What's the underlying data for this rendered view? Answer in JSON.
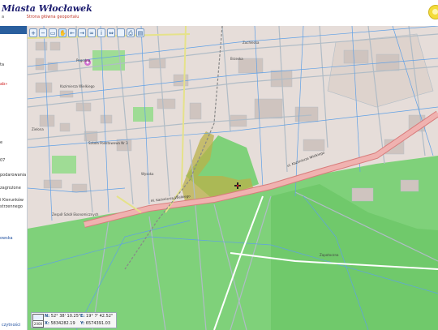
{
  "header": {
    "title": "Miasta Włocławek",
    "subnav_left": "a",
    "subnav_link": "Strona główna geoportalu"
  },
  "sidebar": {
    "items": [
      {
        "label": "ta",
        "style": "normal"
      },
      {
        "label": "ab»",
        "style": "red"
      },
      {
        "label": "e",
        "style": "normal"
      },
      {
        "label": "07",
        "style": "normal"
      },
      {
        "label": "podarowania",
        "style": "normal"
      },
      {
        "label": "zagrożone",
        "style": "normal"
      },
      {
        "label": "i Kierunków",
        "style": "normal"
      },
      {
        "label": "strzennego",
        "style": "normal"
      },
      {
        "label": "owska",
        "style": "blue"
      }
    ],
    "footer_link": "czytności"
  },
  "toolbar": {
    "tools": [
      {
        "name": "zoom-in-icon",
        "glyph": "+"
      },
      {
        "name": "zoom-out-icon",
        "glyph": "−"
      },
      {
        "name": "zoom-box-icon",
        "glyph": "▭"
      },
      {
        "name": "pan-hand-icon",
        "glyph": "✋"
      },
      {
        "name": "back-arrow-icon",
        "glyph": "←"
      },
      {
        "name": "forward-arrow-icon",
        "glyph": "→"
      },
      {
        "name": "link-icon",
        "glyph": "∞"
      },
      {
        "name": "info-icon",
        "glyph": "i"
      },
      {
        "name": "measure-icon",
        "glyph": "⇔"
      },
      {
        "name": "blank-icon",
        "glyph": ""
      },
      {
        "name": "print-icon",
        "glyph": "⎙"
      },
      {
        "name": "layers-icon",
        "glyph": "▤"
      }
    ]
  },
  "map": {
    "labels": {
      "zuchlecka": "Zuchlecka",
      "brzeska": "Brzeska",
      "kasztany": "Kazimierza Wielkiego",
      "zielona": "Zielona",
      "szkoła": "Szkoła Podstawowa Nr 3",
      "pogodna": "Pogodna",
      "wysoka": "Wysoka",
      "zapotoczna": "Zapotoczna",
      "street_main": "Al. Kazimierza Wielkiego",
      "street_right": "ul. Kazimierza Wielkiego",
      "zespol": "Zespół Szkół Ekonomicznych"
    },
    "colors": {
      "urban": "#e6ddd9",
      "forest": "#7fd17a",
      "forest_dark": "#66c361",
      "road_main": "#f0b2b0",
      "road_main_edge": "#d87c7b",
      "water_lines": "#5fa0e6",
      "streets": "#b0bcc6",
      "parcel": "#b9b049"
    }
  },
  "coordinates": {
    "scale_top": "",
    "scale_bottom": "2000",
    "n_label": "N:",
    "n_value": "52° 38' 10.25\"",
    "e_label": "E:",
    "e_value": "19° 7' 42.52\"",
    "x_label": "X:",
    "x_value": "5834282.19",
    "y_label": "Y:",
    "y_value": "6574391.03"
  }
}
